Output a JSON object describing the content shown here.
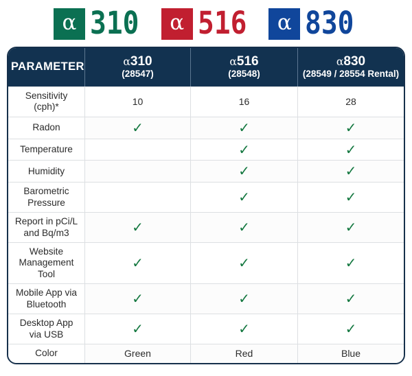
{
  "logos": [
    {
      "name": "alpha310-logo",
      "symbol": "α",
      "number": "310",
      "color": "#0b7052"
    },
    {
      "name": "alpha516-logo",
      "symbol": "α",
      "number": "516",
      "color": "#c11f30"
    },
    {
      "name": "alpha830-logo",
      "symbol": "α",
      "number": "830",
      "color": "#10469b"
    }
  ],
  "table": {
    "header": {
      "parameter_label": "PARAMETER",
      "columns": [
        {
          "alpha": "α",
          "model": "310",
          "sku": "(28547)"
        },
        {
          "alpha": "α",
          "model": "516",
          "sku": "(28548)"
        },
        {
          "alpha": "α",
          "model": "830",
          "sku": "(28549 / 28554 Rental)"
        }
      ]
    },
    "check_symbol": "✓",
    "rows": [
      {
        "parameter": "Sensitivity\n(cph)*",
        "values": [
          "10",
          "16",
          "28"
        ],
        "types": [
          "text",
          "text",
          "text"
        ]
      },
      {
        "parameter": "Radon",
        "values": [
          "✓",
          "✓",
          "✓"
        ],
        "types": [
          "check",
          "check",
          "check"
        ]
      },
      {
        "parameter": "Temperature",
        "values": [
          "",
          "✓",
          "✓"
        ],
        "types": [
          "empty",
          "check",
          "check"
        ]
      },
      {
        "parameter": "Humidity",
        "values": [
          "",
          "✓",
          "✓"
        ],
        "types": [
          "empty",
          "check",
          "check"
        ]
      },
      {
        "parameter": "Barometric\nPressure",
        "values": [
          "",
          "✓",
          "✓"
        ],
        "types": [
          "empty",
          "check",
          "check"
        ]
      },
      {
        "parameter": "Report in pCi/L\nand Bq/m3",
        "values": [
          "✓",
          "✓",
          "✓"
        ],
        "types": [
          "check",
          "check",
          "check"
        ]
      },
      {
        "parameter": "Website\nManagement\nTool",
        "values": [
          "✓",
          "✓",
          "✓"
        ],
        "types": [
          "check",
          "check",
          "check"
        ]
      },
      {
        "parameter": "Mobile App via\nBluetooth",
        "values": [
          "✓",
          "✓",
          "✓"
        ],
        "types": [
          "check",
          "check",
          "check"
        ]
      },
      {
        "parameter": "Desktop App\nvia USB",
        "values": [
          "✓",
          "✓",
          "✓"
        ],
        "types": [
          "check",
          "check",
          "check"
        ]
      },
      {
        "parameter": "Color",
        "values": [
          "Green",
          "Red",
          "Blue"
        ],
        "types": [
          "text",
          "text",
          "text"
        ]
      }
    ]
  },
  "theme": {
    "header_bg": "#123250",
    "header_text": "#ffffff",
    "border": "#16304b",
    "grid": "#dcdfe2",
    "check_color": "#13773f",
    "body_text": "#2b2b2b"
  }
}
